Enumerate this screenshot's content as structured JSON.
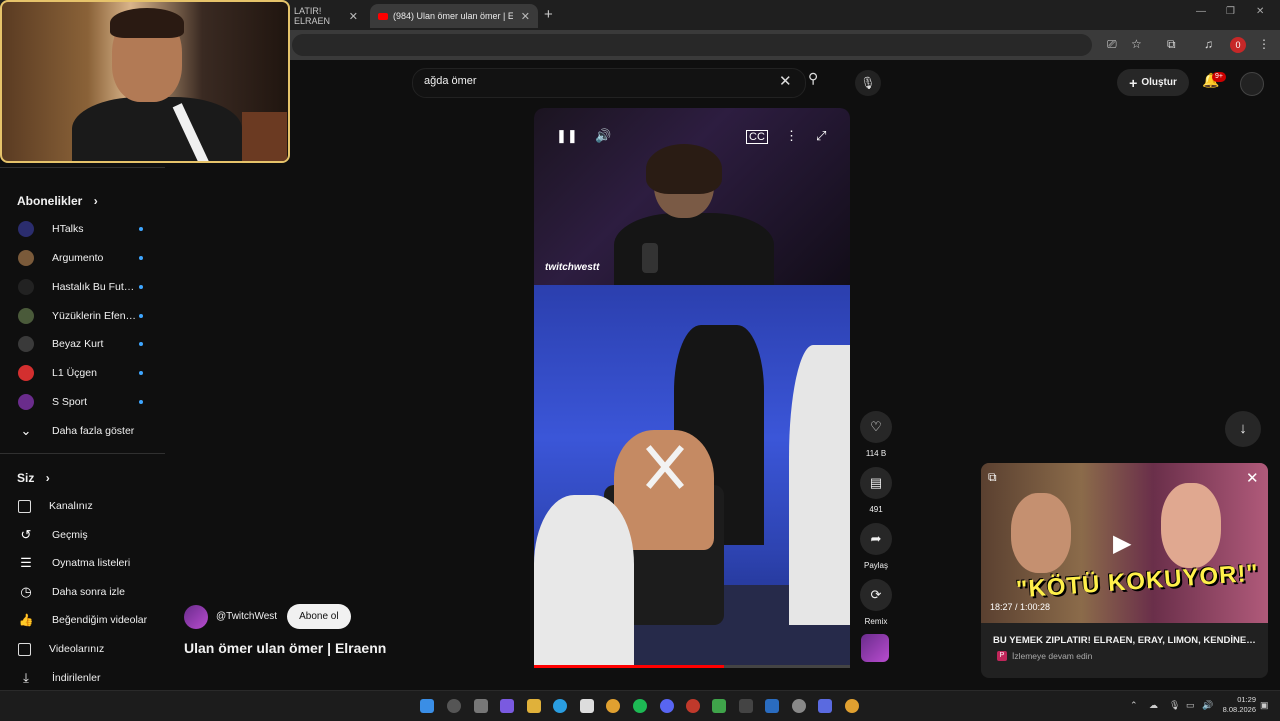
{
  "browser": {
    "tabs": [
      {
        "label": "LATIR! ELRAEN",
        "active": false
      },
      {
        "label": "(984) Ulan ömer ulan ömer | E",
        "active": true
      }
    ],
    "new_tab": "+",
    "profile_badge": "0"
  },
  "header": {
    "search_value": "ağda ömer",
    "create_label": "Oluştur",
    "notification_badge": "9+"
  },
  "sidebar": {
    "subscriptions_title": "Abonelikler",
    "subscriptions": [
      {
        "label": "HTalks",
        "color": "#2b2d6e"
      },
      {
        "label": "Argumento",
        "color": "#7a5a3a"
      },
      {
        "label": "Hastalık Bu Futbol",
        "color": "#222222"
      },
      {
        "label": "Yüzüklerin Efend…",
        "color": "#4a5a3a"
      },
      {
        "label": "Beyaz Kurt",
        "color": "#3a3a3a"
      },
      {
        "label": "L1 Üçgen",
        "color": "#d32f2f"
      },
      {
        "label": "S Sport",
        "color": "#6a2c8c"
      }
    ],
    "show_more": "Daha fazla göster",
    "you_title": "Siz",
    "you_items": [
      {
        "label": "Kanalınız",
        "icon": "channel-icon"
      },
      {
        "label": "Geçmiş",
        "icon": "history-icon"
      },
      {
        "label": "Oynatma listeleri",
        "icon": "playlists-icon"
      },
      {
        "label": "Daha sonra izle",
        "icon": "watch-later-icon"
      },
      {
        "label": "Beğendiğim videolar",
        "icon": "like-icon"
      },
      {
        "label": "Videolarınız",
        "icon": "your-videos-icon"
      },
      {
        "label": "İndirilenler",
        "icon": "downloads-icon"
      }
    ]
  },
  "short": {
    "watermark": "twitchwestt",
    "channel_name": "@TwitchWest",
    "subscribe_label": "Abone ol",
    "title": "Ulan ömer ulan ömer | Elraenn",
    "progress": 0.6,
    "actions": {
      "likes": "114 B",
      "comments": "491",
      "share": "Paylaş",
      "remix": "Remix"
    }
  },
  "miniplayer": {
    "banner_text": "\"KÖTÜ KOKUYOR!\"",
    "time": "18:27 / 1:00:28",
    "title": "BU YEMEK ZIPLATIR! ELRAEN, ERAY, LIMON, KENDİNE M...",
    "subtitle": "İzlemeye devam edin",
    "playlist_icon": "P"
  },
  "taskbar": {
    "time": "01:29",
    "date": "8.08.2026"
  },
  "colors": {
    "background": "#0f0f0f",
    "accent_red": "#ff0000",
    "dot_blue": "#3ea6ff",
    "webcam_border": "#e6c36a"
  }
}
